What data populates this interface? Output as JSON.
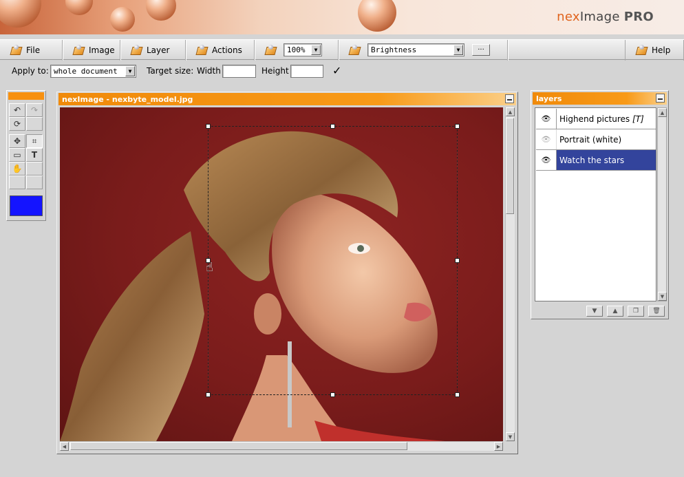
{
  "brand": {
    "nex": "nex",
    "image": "Image",
    "pro": "PRO"
  },
  "menu": {
    "file": "File",
    "image": "Image",
    "layer": "Layer",
    "actions": "Actions",
    "zoom": "100%",
    "filter": "Brightness",
    "more": "···",
    "help": "Help"
  },
  "options": {
    "apply_to_label": "Apply to:",
    "apply_to_value": "whole document",
    "target_size_label": "Target size:",
    "width_label": "Width",
    "width_value": "",
    "height_label": "Height",
    "height_value": "",
    "confirm": "✓"
  },
  "tools": {
    "undo": "↶",
    "redo": "↷",
    "rotate": "⟳",
    "move": "✥",
    "crop": "⌗",
    "marquee": "▭",
    "text": "T",
    "hand": "✋",
    "foreground_color": "#1414ff"
  },
  "image_window": {
    "title": "nexImage - nexbyte_model.jpg"
  },
  "layers": {
    "title": "layers",
    "items": [
      {
        "name": "Highend pictures",
        "suffix": "[T]",
        "visible": true,
        "selected": false
      },
      {
        "name": "Portrait (white)",
        "suffix": "",
        "visible": false,
        "selected": false
      },
      {
        "name": "Watch the stars",
        "suffix": "",
        "visible": true,
        "selected": true
      }
    ],
    "eye_glyph": "👁",
    "buttons": {
      "down": "▼",
      "up": "▲",
      "new": "❐",
      "delete": "🗑"
    }
  },
  "colors": {
    "accent": "#f7900f",
    "selection": "#33449c"
  }
}
